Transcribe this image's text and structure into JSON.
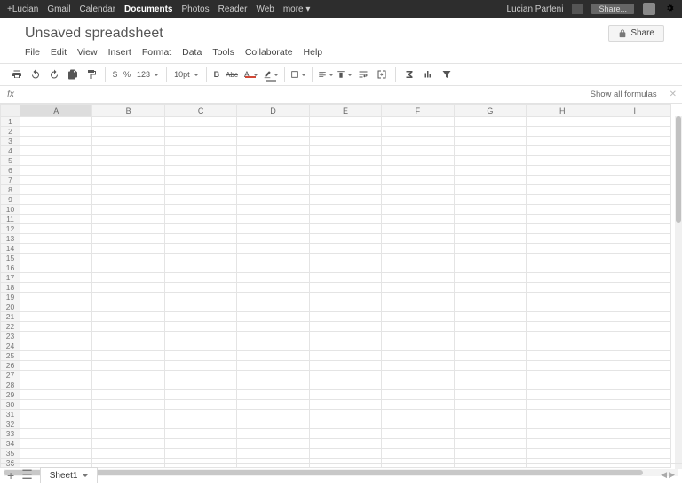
{
  "topbar": {
    "left": [
      "+Lucian",
      "Gmail",
      "Calendar",
      "Documents",
      "Photos",
      "Reader",
      "Web",
      "more ▾"
    ],
    "active_index": 3,
    "user": "Lucian Parfeni",
    "share_label": "Share..."
  },
  "header": {
    "title": "Unsaved spreadsheet",
    "share_button": "Share"
  },
  "menubar": [
    "File",
    "Edit",
    "View",
    "Insert",
    "Format",
    "Data",
    "Tools",
    "Collaborate",
    "Help"
  ],
  "toolbar": {
    "currency": "$",
    "percent": "%",
    "more_formats": "123",
    "font_size": "10pt",
    "bold": "B",
    "strike": "Abc",
    "textcolor": "A"
  },
  "fxbar": {
    "label": "fx",
    "value": "",
    "show_all": "Show all formulas"
  },
  "columns": [
    "A",
    "B",
    "C",
    "D",
    "E",
    "F",
    "G",
    "H",
    "I"
  ],
  "selected_column_index": 0,
  "row_count": 36,
  "sheet_tab": "Sheet1",
  "selected_cell": "A1"
}
